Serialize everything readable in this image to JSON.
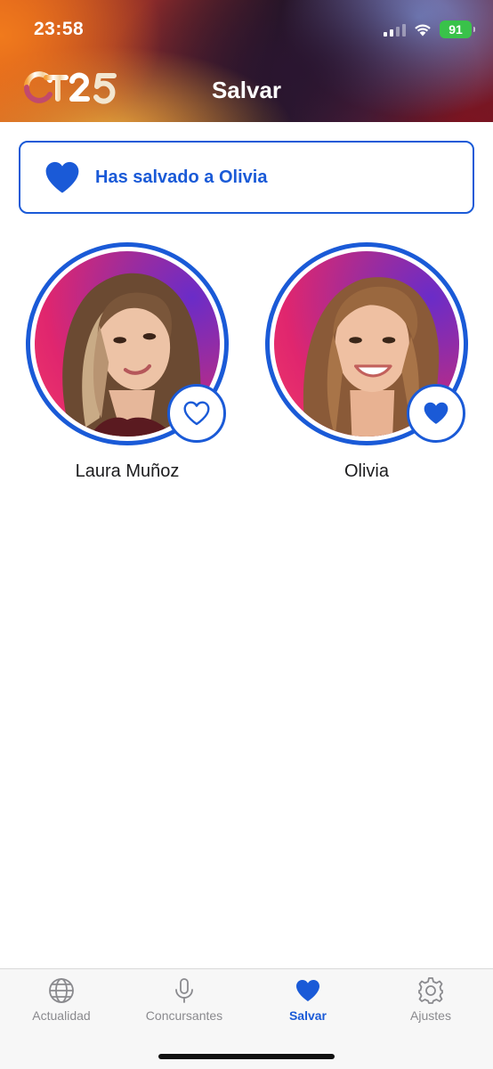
{
  "status_bar": {
    "time": "23:58",
    "battery": "91"
  },
  "header": {
    "logo_text": "OT25",
    "title": "Salvar"
  },
  "banner": {
    "message": "Has salvado a Olivia",
    "icon": "heart-filled-icon"
  },
  "contestants": [
    {
      "name": "Laura Muñoz",
      "saved": false,
      "icon": "heart-outline-icon"
    },
    {
      "name": "Olivia",
      "saved": true,
      "icon": "heart-filled-icon"
    }
  ],
  "tabs": [
    {
      "label": "Actualidad",
      "icon": "globe-icon",
      "active": false
    },
    {
      "label": "Concursantes",
      "icon": "microphone-icon",
      "active": false
    },
    {
      "label": "Salvar",
      "icon": "heart-icon",
      "active": true
    },
    {
      "label": "Ajustes",
      "icon": "gear-icon",
      "active": false
    }
  ],
  "colors": {
    "accent": "#1a5ad7",
    "inactive_tab": "#8a8a8e",
    "battery": "#39c24a"
  }
}
